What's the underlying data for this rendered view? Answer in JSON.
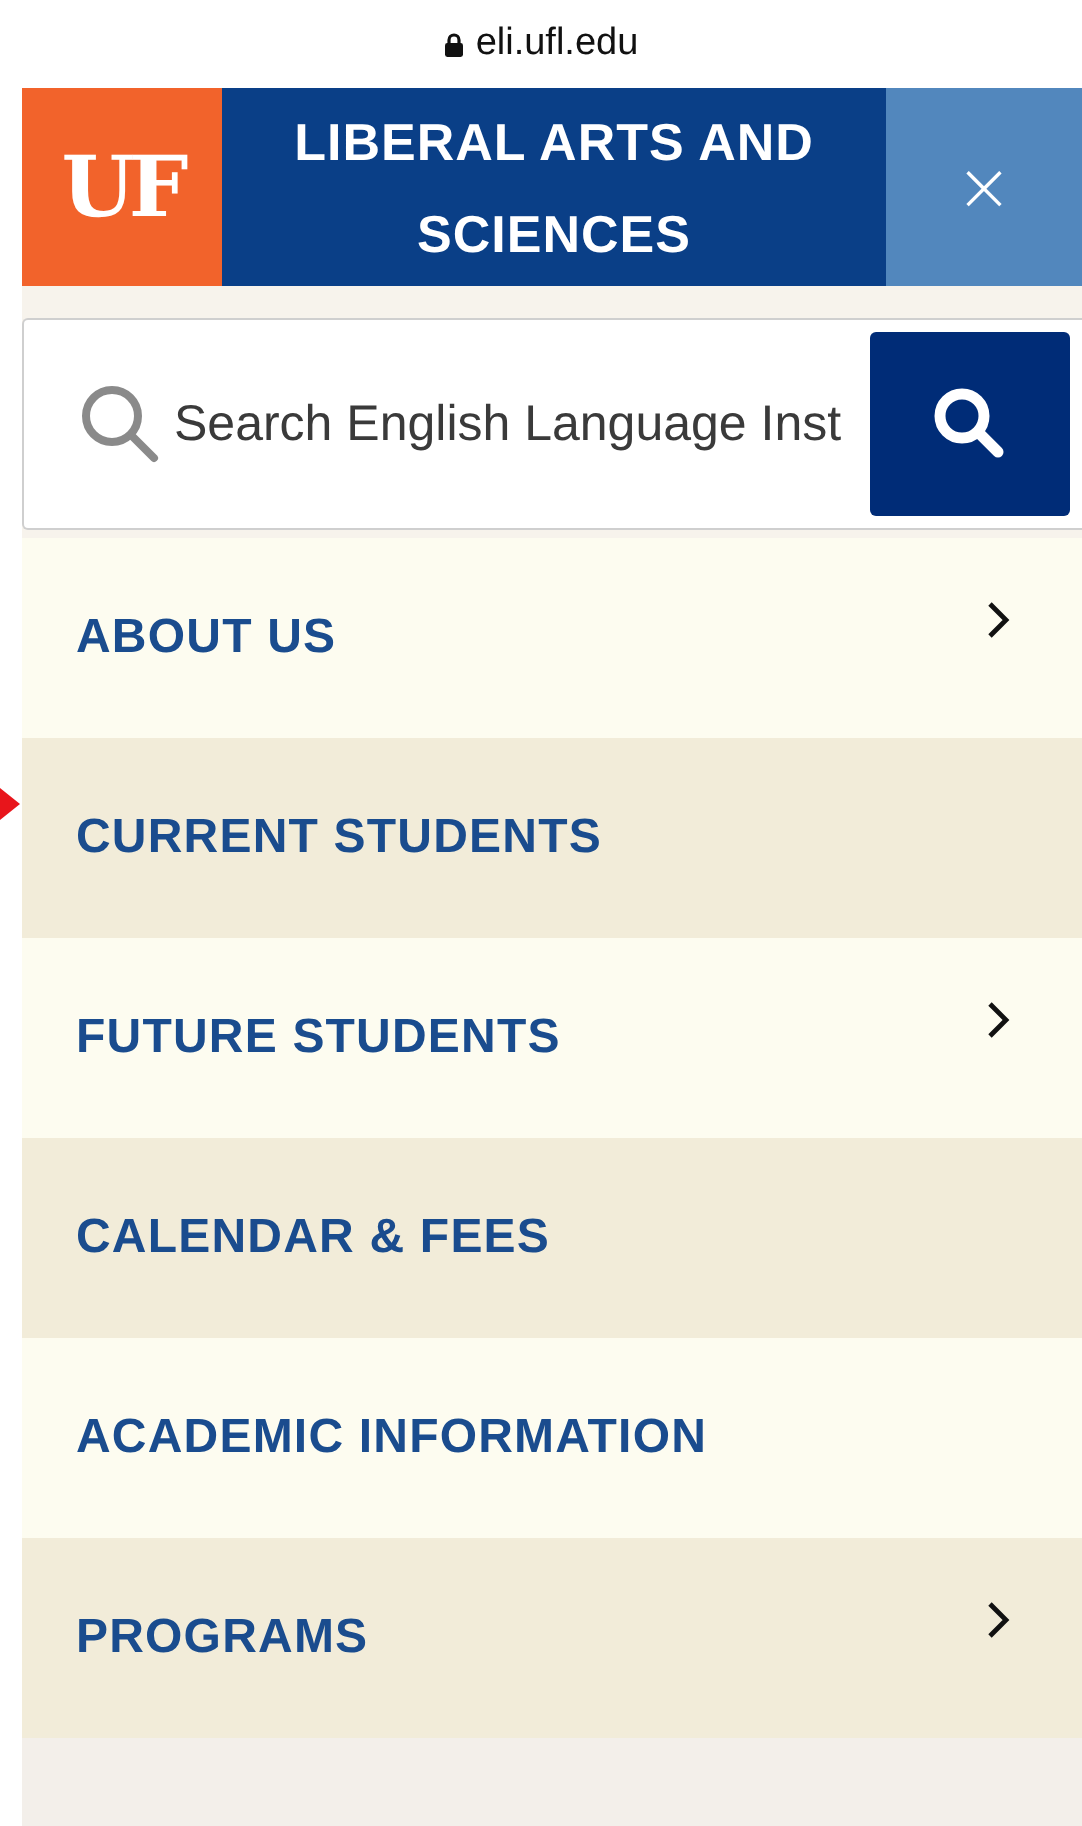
{
  "address_bar": {
    "url": "eli.ufl.edu"
  },
  "header": {
    "logo": "UF",
    "title": "LIBERAL ARTS AND SCIENCES",
    "close": "×"
  },
  "search": {
    "placeholder": "Search English Language Inst"
  },
  "menu": [
    {
      "label": "ABOUT US",
      "has_submenu": true
    },
    {
      "label": "CURRENT STUDENTS",
      "has_submenu": false
    },
    {
      "label": "FUTURE STUDENTS",
      "has_submenu": true
    },
    {
      "label": "CALENDAR & FEES",
      "has_submenu": false
    },
    {
      "label": "ACADEMIC INFORMATION",
      "has_submenu": false
    },
    {
      "label": "PROGRAMS",
      "has_submenu": true
    }
  ],
  "annotation": {
    "kind": "arrow",
    "color": "#e8151b"
  }
}
